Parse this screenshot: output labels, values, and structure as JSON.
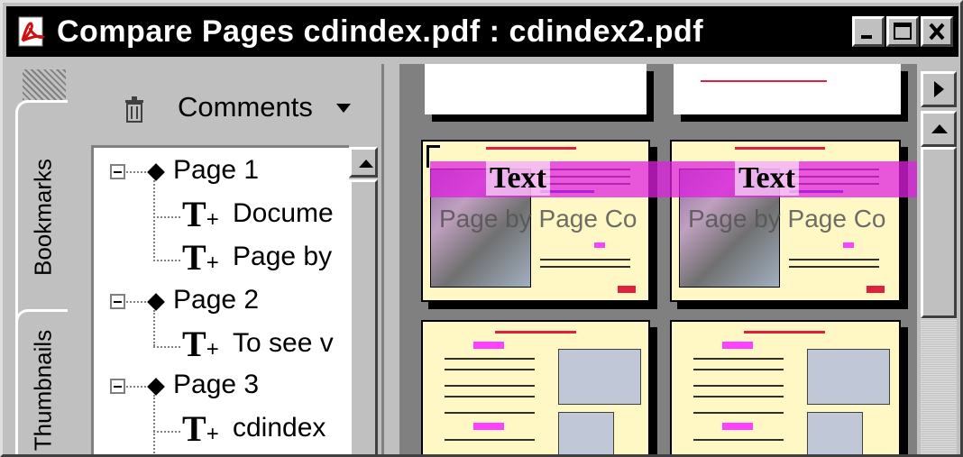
{
  "window": {
    "title": "Compare Pages cdindex.pdf : cdindex2.pdf",
    "icons": {
      "app": "acrobat-icon",
      "minimize": "minimize-icon",
      "maximize": "maximize-icon",
      "close": "close-icon"
    }
  },
  "side_tabs": {
    "bookmarks": "Bookmarks",
    "thumbnails": "Thumbnails"
  },
  "comments_panel": {
    "menu_label": "Comments",
    "icons": {
      "delete": "trash-icon",
      "dropdown": "caret-down-icon"
    },
    "tree": [
      {
        "label": "Page 1",
        "children": [
          "Docume",
          "Page by"
        ]
      },
      {
        "label": "Page 2",
        "children": [
          "To see v"
        ]
      },
      {
        "label": "Page 3",
        "children": [
          "cdindex"
        ]
      }
    ],
    "icon_names": {
      "expander": "collapse-icon",
      "page": "diamond-icon",
      "note": "text-note-icon"
    }
  },
  "document_view": {
    "overlay_text_left": "Page by Page Co",
    "overlay_text_right": "Page by Page Co",
    "overlay_title": "Text",
    "overlay_color": "#e020e0",
    "page_bg": "#fff8c4"
  }
}
